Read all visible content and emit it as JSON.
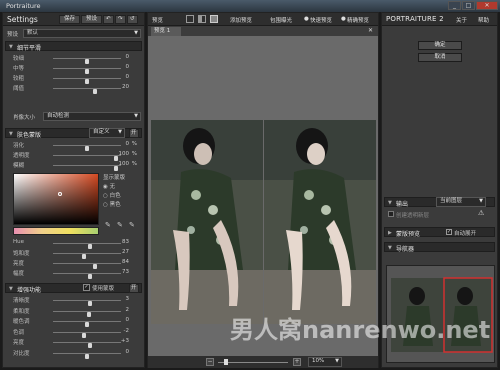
{
  "window": {
    "title": "Portraiture",
    "min": "_",
    "max": "□",
    "close": "✕"
  },
  "left": {
    "settings_label": "Settings",
    "save_label": "保存",
    "preset_label": "预设",
    "preset_row_label": "预设",
    "preset_value": "默认",
    "detail_section": "细节平滑",
    "detail_sliders": [
      {
        "label": "较细",
        "value": "0",
        "pos": 0.5
      },
      {
        "label": "中等",
        "value": "0",
        "pos": 0.5
      },
      {
        "label": "较粗",
        "value": "0",
        "pos": 0.5
      },
      {
        "label": "阈值",
        "value": "20",
        "pos": 0.62
      }
    ],
    "portrait_size_label": "肖像大小",
    "portrait_size_value": "自动检测",
    "mask_section": "肤色蒙版",
    "mask_mode": "自定义",
    "mask_toggle": "开",
    "mask_sliders": [
      {
        "label": "羽化",
        "value": "0",
        "unit": "%",
        "pos": 0.5
      },
      {
        "label": "透明度",
        "value": "100",
        "unit": "%",
        "pos": 0.95
      },
      {
        "label": "模糊",
        "value": "100",
        "unit": "%",
        "pos": 0.95
      }
    ],
    "show_mask_label": "显示蒙版",
    "show_mask_options": [
      "无",
      "白色",
      "黑色"
    ],
    "show_mask_selected": 0,
    "color_sliders": [
      {
        "label": "Hue",
        "value": "83",
        "pos": 0.55
      },
      {
        "label": "饱和度",
        "value": "27",
        "pos": 0.45
      },
      {
        "label": "亮度",
        "value": "84",
        "pos": 0.62
      },
      {
        "label": "幅度",
        "value": "73",
        "pos": 0.55
      }
    ],
    "enhance_section": "增强功能",
    "enhance_checkbox": "使用蒙版",
    "enhance_toggle": "开",
    "enhance_sliders": [
      {
        "label": "清晰度",
        "value": "3",
        "pos": 0.55
      },
      {
        "label": "柔和度",
        "value": "2",
        "pos": 0.53
      },
      {
        "label": "暖色调",
        "value": "0",
        "pos": 0.5
      },
      {
        "label": "色调",
        "value": "-2",
        "pos": 0.46
      },
      {
        "label": "亮度",
        "value": "+3",
        "pos": 0.55
      },
      {
        "label": "对比度",
        "value": "0",
        "pos": 0.5
      }
    ]
  },
  "center": {
    "preview_label": "预览",
    "add_preview": "添加预览",
    "clip_exposure": "包围曝光",
    "fast_preview": "快速预览",
    "precise_preview": "精确预览",
    "tab": "预览 1",
    "zoom_value": "10%"
  },
  "right": {
    "logo": "PORTRAITURE 2",
    "about": "关于",
    "help": "帮助",
    "ok": "确定",
    "cancel": "取消",
    "output_label": "输出",
    "output_value": "当前图层",
    "create_new_layer": "创建透明新层",
    "mask_preview": "蒙版预览",
    "auto_expand": "自动展开",
    "navigator": "导航器"
  },
  "watermark": "男人窝nanrenwo.net"
}
